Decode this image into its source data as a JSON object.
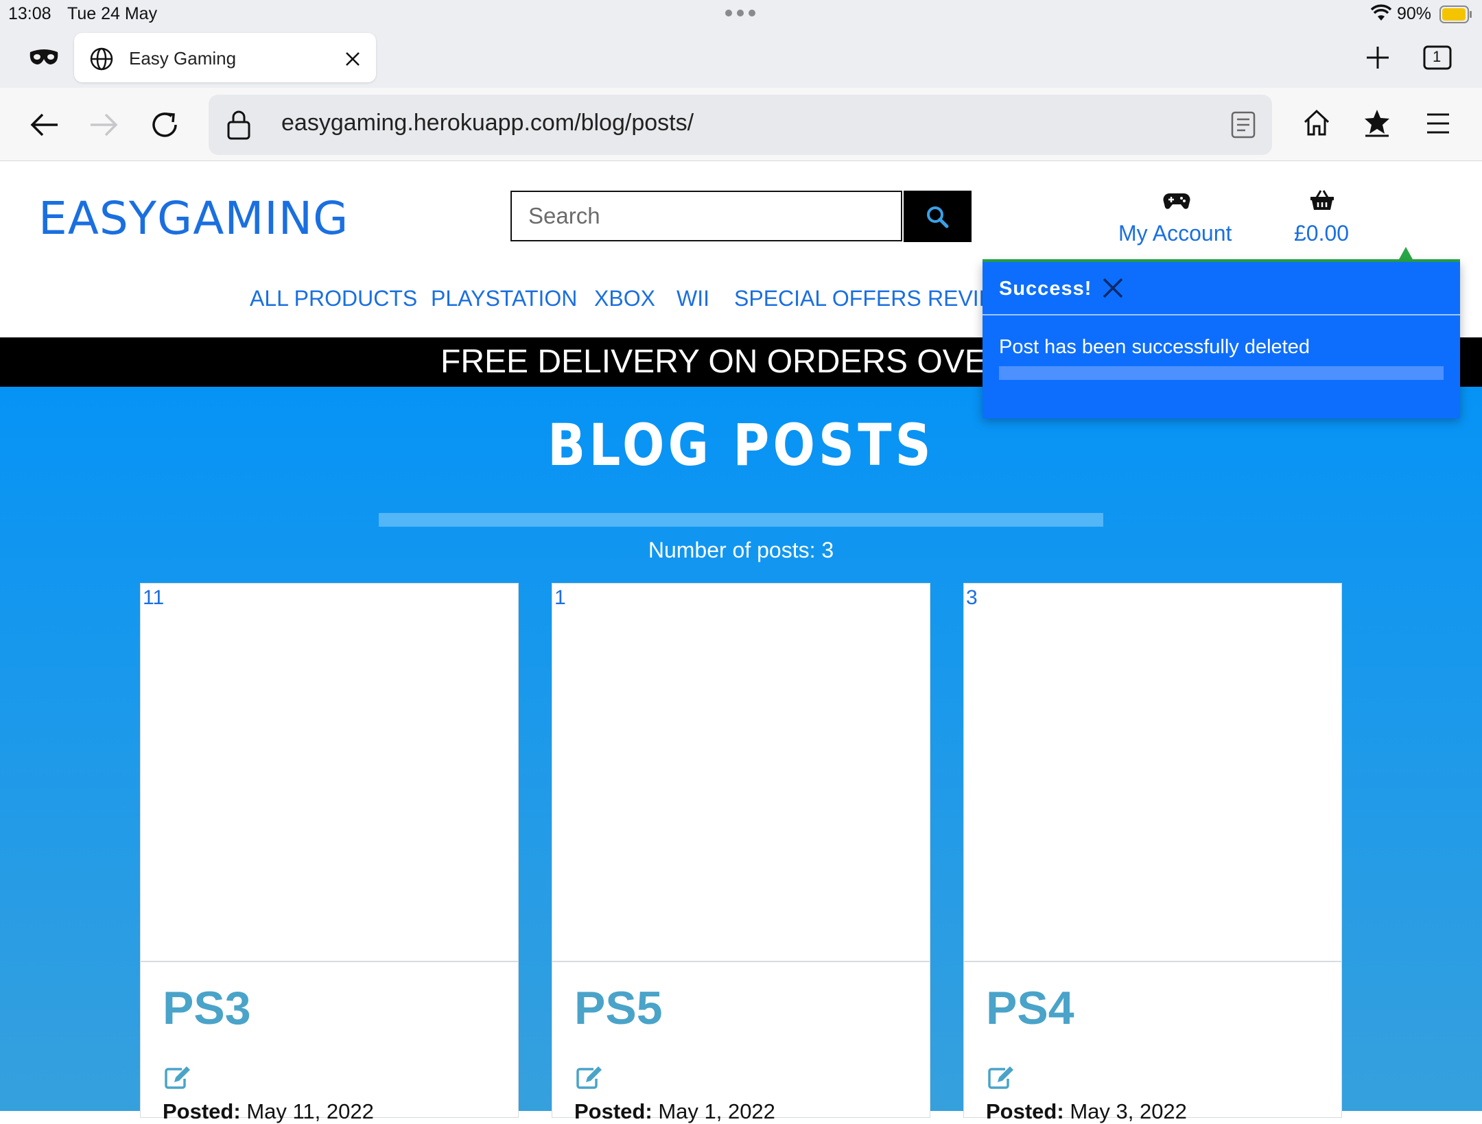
{
  "status_bar": {
    "time": "13:08",
    "date": "Tue 24 May",
    "battery": "90%"
  },
  "browser": {
    "tab_title": "Easy Gaming",
    "tab_count": "1",
    "url": "easygaming.herokuapp.com/blog/posts/"
  },
  "site": {
    "logo": "EASYGAMING",
    "search_placeholder": "Search",
    "account_label": "My Account",
    "cart_total": "£0.00",
    "nav": [
      "ALL PRODUCTS",
      "PLAYSTATION",
      "XBOX",
      "WII",
      "SPECIAL OFFERS",
      "REVIE"
    ],
    "banner": "FREE DELIVERY ON ORDERS OVER £"
  },
  "page": {
    "title": "BLOG POSTS",
    "post_count": "Number of posts: 3"
  },
  "posts": [
    {
      "id": "11",
      "title": "PS3",
      "posted_label": "Posted:",
      "posted_date": "May 11, 2022"
    },
    {
      "id": "1",
      "title": "PS5",
      "posted_label": "Posted:",
      "posted_date": "May 1, 2022"
    },
    {
      "id": "3",
      "title": "PS4",
      "posted_label": "Posted:",
      "posted_date": "May 3, 2022"
    }
  ],
  "toast": {
    "title": "Success!",
    "message": "Post has been successfully deleted"
  },
  "colors": {
    "brand_blue": "#1a6fe0",
    "toast_blue": "#0d6efd",
    "toast_accent_green": "#28a745",
    "card_title": "#4aa3c9"
  }
}
